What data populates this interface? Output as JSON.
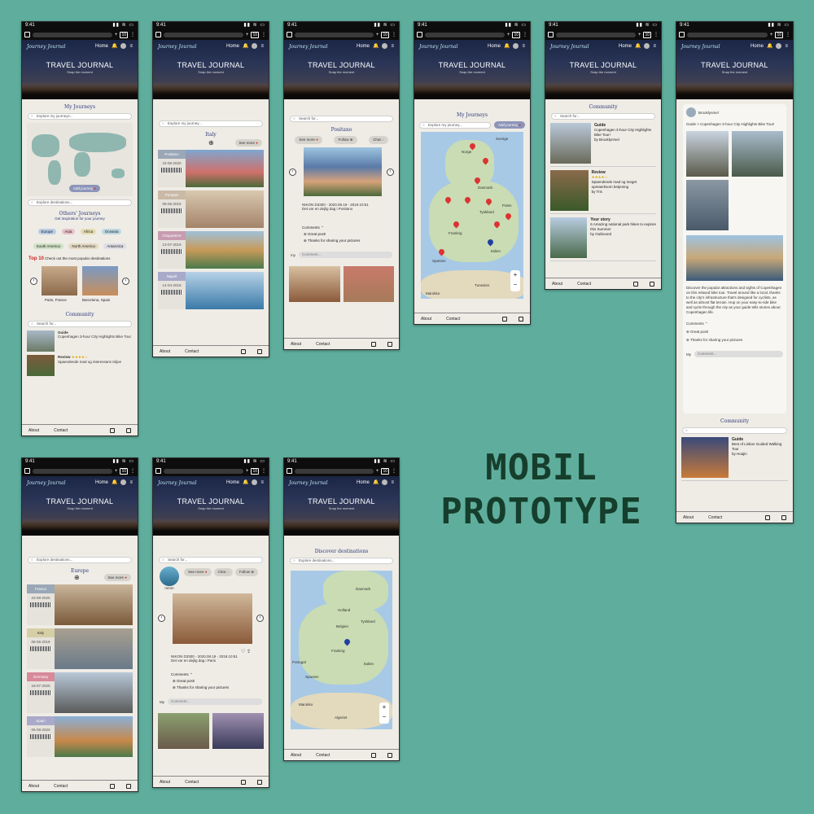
{
  "poster_title": [
    "MOBIL",
    "PROTOTYPE"
  ],
  "common": {
    "time": "9:41",
    "tabs": "10",
    "nav_home": "Home",
    "hero_title": "TRAVEL JOURNAL",
    "hero_sub": "Snap the moment",
    "logo": "Journey Journal",
    "footer_about": "About",
    "footer_contact": "Contact"
  },
  "s1": {
    "section": "My Journeys",
    "search_journeys": "Explore my journeys...",
    "add_journey": "Add journey",
    "search_destinations": "Explore destinations...",
    "others_title": "Others' Journeys",
    "others_sub": "Get inspiration for your journey",
    "continents": [
      {
        "label": "Europe",
        "color": "#b8cde6"
      },
      {
        "label": "Asia",
        "color": "#e6c2c8"
      },
      {
        "label": "Africa",
        "color": "#e5dcb2"
      },
      {
        "label": "Oceania",
        "color": "#bcd8e2"
      },
      {
        "label": "South America",
        "color": "#cfe0c4"
      },
      {
        "label": "North America",
        "color": "#e4d8c2"
      },
      {
        "label": "Antarctica",
        "color": "#dcdde6"
      }
    ],
    "top10_prefix": "Top 10",
    "top10_text": "Check out the most popular destinations",
    "dest1": "Paris, France",
    "dest2": "Barcelona, Spain",
    "community": "Community",
    "search_for": "Search for...",
    "c1_type": "Guide",
    "c1_text": "Copenhagen 3-hour City Highlights Bike Tour",
    "c2_type": "Review",
    "c2_text": "Spaendende mad og interessant miljoe"
  },
  "s2": {
    "search": "Explore my journey...",
    "country": "Italy",
    "see_more": "See more",
    "cards": [
      {
        "name": "Positano",
        "date": "23-08-2020",
        "color": "#9aa7b7"
      },
      {
        "name": "Pompeii",
        "date": "08-06-2019",
        "color": "#c9b9a6"
      },
      {
        "name": "Cinqueterre",
        "date": "13-07-2019",
        "color": "#c79cb0"
      },
      {
        "name": "Napoli",
        "date": "14-04-2019",
        "color": "#a9a9c9"
      }
    ]
  },
  "s3": {
    "search": "Search for...",
    "place": "Positano",
    "see_more": "See more",
    "follow": "Follow",
    "chat": "Chat",
    "camera": "NIKON D3300 - 2020.08.19 - 2019.10:51",
    "caption": "Det var en dejlig dag i Positano",
    "comments": "Comments",
    "comment1": "Great post!",
    "comment2": "Thanks for sharing your pictures",
    "input_prefix": "my",
    "input_placeholder": "Comment..."
  },
  "s4": {
    "section": "My Journeys",
    "search": "Explore my journey...",
    "add": "Add journey",
    "map_labels": [
      "Norge",
      "Sverige",
      "Danmark",
      "Polen",
      "Tyskland",
      "Frankrig",
      "Spanien",
      "Italien",
      "Marokko",
      "Tunesien"
    ]
  },
  "s5": {
    "section": "Community",
    "search": "Search for...",
    "items": [
      {
        "type": "Guide",
        "title": "Copenhagen 3-hour City Highlights Bike Tour!",
        "by": "by Brooklynmel"
      },
      {
        "type": "Review",
        "title": "Spaendende mad og meget opmaerksom betjening",
        "by": "by Tris",
        "rating": 4
      },
      {
        "type": "Your story",
        "title": "6 Amazing national park hikes to explore this Summer",
        "by": "by Outbound"
      }
    ]
  },
  "s6": {
    "author": "Brooklynmel",
    "crumb": "Guide > Copenhagen 3-hour City Highlights Bike Tour!",
    "body": "Discover the popular attractions and sights of Copenhagen on this relaxed bike tour. Travel around like a local, thanks to the city's infrastructure that's designed for cyclists, as well as almost flat terrain. Hop on your easy-to-ride bike and cycle through the city as your guide tells stories about Copenhagen life.",
    "comments": "Comments",
    "comment1": "Great post!",
    "comment2": "Thanks for sharing your pictures",
    "input_prefix": "My",
    "input_placeholder": "Comment...",
    "community": "Community",
    "guide_type": "Guide",
    "guide_title": "Best of Lisbon Guided Walking Tour",
    "guide_by": "by Hoajin"
  },
  "s7": {
    "search": "Explore destinations...",
    "region": "Europe",
    "see_more": "See more",
    "cards": [
      {
        "name": "France",
        "date": "23-08-2020",
        "color": "#9aa7b7"
      },
      {
        "name": "Italy",
        "date": "08-06-2019",
        "color": "#d6cfa6"
      },
      {
        "name": "Germany",
        "date": "18-07-2020",
        "color": "#d78a9a"
      },
      {
        "name": "Spain",
        "date": "05-08-2020",
        "color": "#a9a9c9"
      }
    ]
  },
  "s8": {
    "search": "Search for...",
    "user": "mmm",
    "see_more": "See more",
    "chat": "Chat",
    "follow": "Follow",
    "camera": "NIKON D3300 - 2020.08.19 - 2019.10:51",
    "caption": "Det var en dejlig dag i Paris",
    "comments": "Comments",
    "comment1": "Great post!",
    "comment2": "Thanks for sharing your pictures",
    "input_prefix": "My",
    "input_placeholder": "Comment..."
  },
  "s9": {
    "section": "Discover destinations",
    "search": "Explore destinations...",
    "map_labels": [
      "Danmark",
      "Holland",
      "Tyskland",
      "Belgien",
      "Frankrig",
      "Spanien",
      "Portugal",
      "Italien",
      "Marokko",
      "Algeriet"
    ]
  }
}
